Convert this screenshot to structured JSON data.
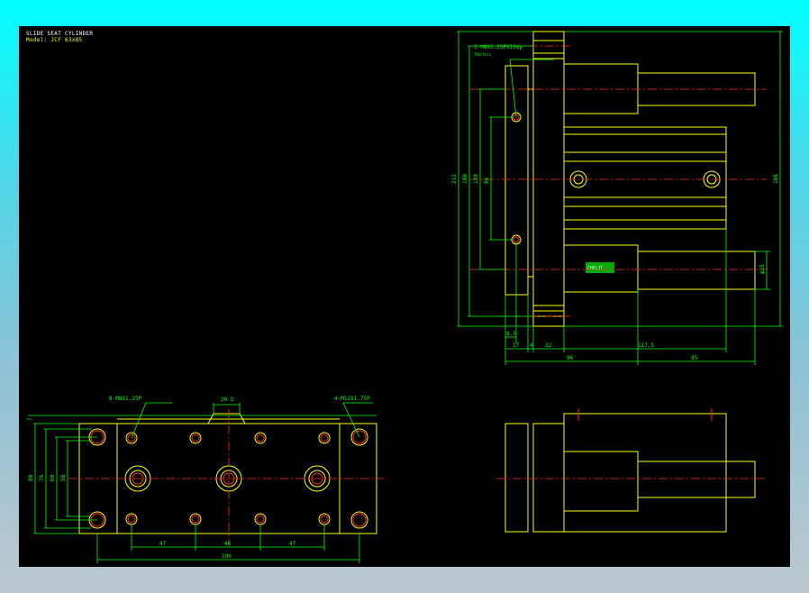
{
  "title_block": {
    "title": "SLIDE SEAT CYLINDER",
    "model": "Model: JCF 63x85"
  },
  "colors": {
    "background": "#000000",
    "outline": "#ffff00",
    "dimension": "#00ff00",
    "centerline": "#ff2a2a",
    "frame_gradient_top": "#00ffff",
    "frame_gradient_bottom": "#bcc6ce"
  },
  "side_view": {
    "callout_top": "2-M8X1.25PX15dp",
    "callout_top_sub": "TRU/thru",
    "label_badge": "CHELIC",
    "dims": {
      "d212": "212",
      "d180": "180",
      "d130": "130",
      "d88": "88",
      "d8_5": "8.5",
      "d17": "17",
      "d4": "4",
      "d22": "22",
      "d117_5": "117.5",
      "d96": "96",
      "d85": "85",
      "d166": "166",
      "dphi25": "φ25"
    }
  },
  "plan_view": {
    "callout_left": "8-M8X1.25P",
    "callout_right": "4-M12X1.75P",
    "dims": {
      "d20_5": "20.5",
      "d7": "7",
      "d80": "80",
      "d76": "76",
      "d60": "60",
      "d58": "58",
      "d47a": "47",
      "d46": "46",
      "d47b": "47",
      "d190": "190"
    }
  }
}
